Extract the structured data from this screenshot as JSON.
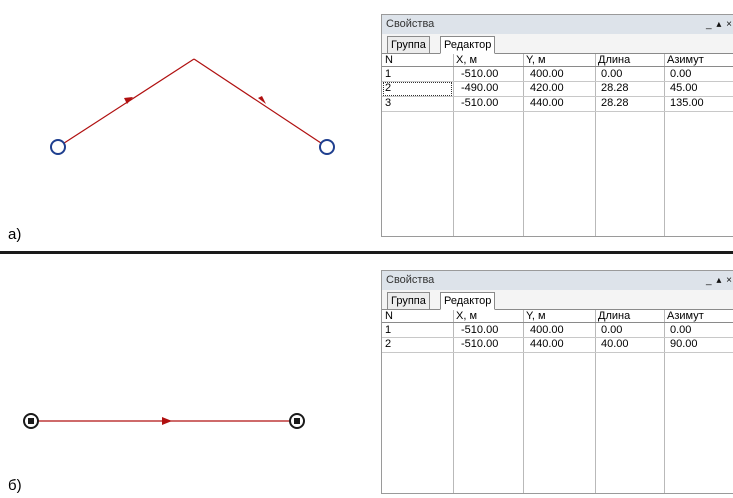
{
  "figure_a": {
    "label": "а)",
    "panel": {
      "title": "Свойства",
      "controls": "_ ▴ ×",
      "tabs": [
        "Группа",
        "Редактор"
      ],
      "columns": [
        "N",
        "X, м",
        "Y, м",
        "Длина",
        "Азимут"
      ],
      "rows": [
        [
          "1",
          "-510.00",
          "400.00",
          "0.00",
          "0.00"
        ],
        [
          "2",
          "-490.00",
          "420.00",
          "28.28",
          "45.00"
        ],
        [
          "3",
          "-510.00",
          "440.00",
          "28.28",
          "135.00"
        ]
      ]
    }
  },
  "figure_b": {
    "label": "б)",
    "panel": {
      "title": "Свойства",
      "controls": "_ ▴ ×",
      "tabs": [
        "Группа",
        "Редактор"
      ],
      "columns": [
        "N",
        "X, м",
        "Y, м",
        "Длина",
        "Азимут"
      ],
      "rows": [
        [
          "1",
          "-510.00",
          "400.00",
          "0.00",
          "0.00"
        ],
        [
          "2",
          "-510.00",
          "440.00",
          "40.00",
          "90.00"
        ]
      ]
    }
  },
  "colors": {
    "line": "#b01010",
    "vertex": "#1f3f8f"
  }
}
